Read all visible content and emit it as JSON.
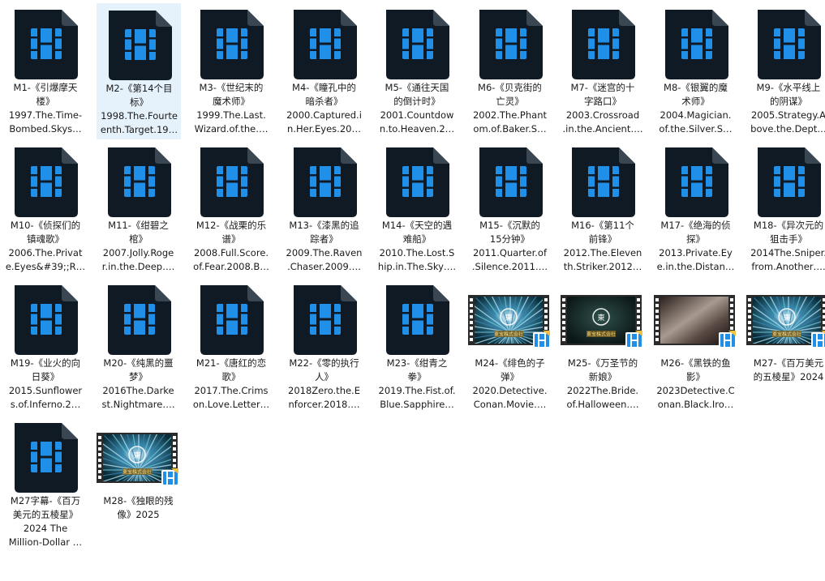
{
  "colors": {
    "selection": "#e5f1fb",
    "icon_dark": "#101a24",
    "icon_fold": "#3b4653",
    "icon_blue": "#1f8fe8",
    "label_text": "#1a1a1a"
  },
  "icons": {
    "video_file": "video-file-icon",
    "video_thumbnail": "video-thumbnail-icon",
    "video_badge": "video-badge-icon"
  },
  "items": [
    {
      "id": "M1",
      "icon": "video-file-icon",
      "label": [
        "M1-《引爆摩天",
        "楼》",
        "1997.The.Time-",
        "Bombed.Skys…"
      ]
    },
    {
      "id": "M2",
      "icon": "video-file-icon",
      "selected": true,
      "label": [
        "M2-《第14个目",
        "标》",
        "1998.The.Fourte",
        "enth.Target.19…"
      ]
    },
    {
      "id": "M3",
      "icon": "video-file-icon",
      "label": [
        "M3-《世纪末的",
        "魔术师》",
        "1999.The.Last.",
        "Wizard.of.the…."
      ]
    },
    {
      "id": "M4",
      "icon": "video-file-icon",
      "label": [
        "M4-《瞳孔中的",
        "暗杀者》",
        "2000.Captured.i",
        "n.Her.Eyes.20…"
      ]
    },
    {
      "id": "M5",
      "icon": "video-file-icon",
      "label": [
        "M5-《通往天国",
        "的倒计时》",
        "2001.Countdow",
        "n.to.Heaven.2…"
      ]
    },
    {
      "id": "M6",
      "icon": "video-file-icon",
      "label": [
        "M6-《贝克街的",
        "亡灵》",
        "2002.The.Phant",
        "om.of.Baker.S…"
      ]
    },
    {
      "id": "M7",
      "icon": "video-file-icon",
      "label": [
        "M7-《迷宫的十",
        "字路口》",
        "2003.Crossroad",
        ".in.the.Ancient…."
      ]
    },
    {
      "id": "M8",
      "icon": "video-file-icon",
      "label": [
        "M8-《银翼的魔",
        "术师》",
        "2004.Magician.",
        "of.the.Silver.S…"
      ]
    },
    {
      "id": "M9",
      "icon": "video-file-icon",
      "label": [
        "M9-《水平线上",
        "的阴谋》",
        "2005.Strategy.A",
        "bove.the.Dept…"
      ]
    },
    {
      "id": "M10",
      "icon": "video-file-icon",
      "label": [
        "M10-《侦探们的",
        "镇魂歌》",
        "2006.The.Privat",
        "e.Eyes&#39;;R…"
      ]
    },
    {
      "id": "M11",
      "icon": "video-file-icon",
      "label": [
        "M11-《绀碧之",
        "棺》",
        "2007.Jolly.Roge",
        "r.in.the.Deep…."
      ]
    },
    {
      "id": "M12",
      "icon": "video-file-icon",
      "label": [
        "M12-《战栗的乐",
        "谱》",
        "2008.Full.Score.",
        "of.Fear.2008.B…"
      ]
    },
    {
      "id": "M13",
      "icon": "video-file-icon",
      "label": [
        "M13-《漆黑的追",
        "踪者》",
        "2009.The.Raven",
        ".Chaser.2009…."
      ]
    },
    {
      "id": "M14",
      "icon": "video-file-icon",
      "label": [
        "M14-《天空的遇",
        "难船》",
        "2010.The.Lost.S",
        "hip.in.The.Sky…."
      ]
    },
    {
      "id": "M15",
      "icon": "video-file-icon",
      "label": [
        "M15-《沉默的",
        "15分钟》",
        "2011.Quarter.of",
        ".Silence.2011…."
      ]
    },
    {
      "id": "M16",
      "icon": "video-file-icon",
      "label": [
        "M16-《第11个",
        "前锋》",
        "2012.The.Eleven",
        "th.Striker.2012…"
      ]
    },
    {
      "id": "M17",
      "icon": "video-file-icon",
      "label": [
        "M17-《绝海的侦",
        "探》",
        "2013.Private.Ey",
        "e.in.the.Distan…"
      ]
    },
    {
      "id": "M18",
      "icon": "video-file-icon",
      "label": [
        "M18-《异次元的",
        "狙击手》",
        "2014The.Sniper.",
        "from.Another…."
      ]
    },
    {
      "id": "M19",
      "icon": "video-file-icon",
      "label": [
        "M19-《业火的向",
        "日葵》",
        "2015.Sunflower",
        "s.of.Inferno.2…"
      ]
    },
    {
      "id": "M20",
      "icon": "video-file-icon",
      "label": [
        "M20-《纯黑的噩",
        "梦》",
        "2016The.Darke",
        "st.Nightmare…."
      ]
    },
    {
      "id": "M21",
      "icon": "video-file-icon",
      "label": [
        "M21-《唐红的恋",
        "歌》",
        "2017.The.Crims",
        "on.Love.Letter…"
      ]
    },
    {
      "id": "M22",
      "icon": "video-file-icon",
      "label": [
        "M22-《零的执行",
        "人》",
        "2018Zero.the.E",
        "nforcer.2018…."
      ]
    },
    {
      "id": "M23",
      "icon": "video-file-icon",
      "label": [
        "M23-《绀青之",
        "拳》",
        "2019.The.Fist.of.",
        "Blue.Sapphire…"
      ]
    },
    {
      "id": "M24",
      "icon": "video-thumbnail-icon",
      "thumb": "burst",
      "label": [
        "M24-《绯色的子",
        "弹》",
        "2020.Detective.",
        "Conan.Movie…."
      ]
    },
    {
      "id": "M25",
      "icon": "video-thumbnail-icon",
      "thumb": "dark",
      "label": [
        "M25-《万圣节的",
        "新娘》",
        "2022The.Bride.",
        "of.Halloween…."
      ]
    },
    {
      "id": "M26",
      "icon": "video-thumbnail-icon",
      "thumb": "fog",
      "label": [
        "M26-《黑铁的鱼",
        "影》",
        "2023Detective.C",
        "onan.Black.Iro…"
      ]
    },
    {
      "id": "M27",
      "icon": "video-thumbnail-icon",
      "thumb": "burst",
      "label": [
        "M27-《百万美元",
        "的五棱星》2024"
      ]
    },
    {
      "id": "M27s",
      "icon": "video-file-icon",
      "label": [
        "M27字幕-《百万",
        "美元的五棱星》",
        "2024 The",
        "Million-Dollar …"
      ]
    },
    {
      "id": "M28",
      "icon": "video-thumbnail-icon",
      "thumb": "burst",
      "label": [
        "M28-《独眼的残",
        "像》2025"
      ]
    }
  ],
  "thumbnail_logo_text": "東宝株式会社"
}
